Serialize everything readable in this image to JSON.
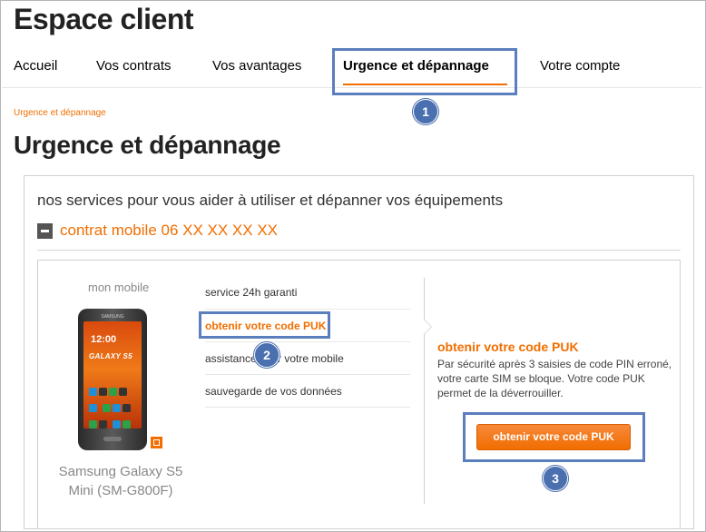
{
  "app": {
    "title": "Espace client"
  },
  "nav": {
    "items": [
      {
        "label": "Accueil"
      },
      {
        "label": "Vos contrats"
      },
      {
        "label": "Vos avantages"
      },
      {
        "label": "Urgence et dépannage",
        "active": true
      },
      {
        "label": "Votre compte"
      }
    ]
  },
  "breadcrumb": "Urgence et dépannage",
  "page_title": "Urgence et dépannage",
  "intro": "nos services pour vous aider à utiliser et dépanner vos équipements",
  "contract": {
    "label": "contrat mobile 06 XX XX XX XX",
    "icon": "collapse-minus-icon"
  },
  "device": {
    "section_label": "mon mobile",
    "name_line1": "Samsung Galaxy S5",
    "name_line2": "Mini (SM-G800F)",
    "screen_brand": "SAMSUNG",
    "screen_time": "12:00",
    "screen_model": "GALAXY S5"
  },
  "services": [
    {
      "label": "service 24h garanti"
    },
    {
      "label": "obtenir votre code PUK",
      "active": true
    },
    {
      "label": "assistance pour votre mobile"
    },
    {
      "label": "sauvegarde de vos données"
    }
  ],
  "detail": {
    "title": "obtenir votre code PUK",
    "text": "Par sécurité après 3 saisies de code PIN erroné, votre carte SIM se bloque. Votre code PUK permet de la déverrouiller.",
    "button_label": "obtenir votre code PUK"
  },
  "annotations": {
    "badge1": "1",
    "badge2": "2",
    "badge3": "3"
  },
  "colors": {
    "accent": "#f16e00",
    "highlight": "#5b7ebd",
    "badge": "#4a70b0"
  }
}
